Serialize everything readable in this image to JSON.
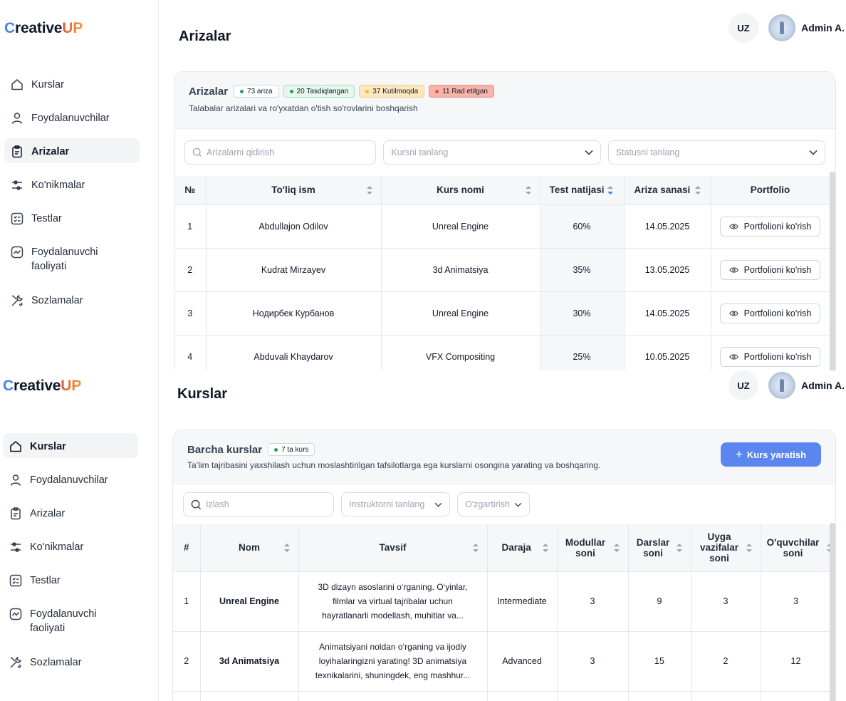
{
  "brand": {
    "c": "C",
    "reative": "reative",
    "up": "UP"
  },
  "nav": [
    {
      "label": "Kurslar",
      "icon": "home-icon"
    },
    {
      "label": "Foydalanuvchilar",
      "icon": "user-icon"
    },
    {
      "label": "Arizalar",
      "icon": "clipboard-icon"
    },
    {
      "label": "Ko'nikmalar",
      "icon": "sliders-icon"
    },
    {
      "label": "Testlar",
      "icon": "checklist-icon"
    },
    {
      "label": "Foydalanuvchi faoliyati",
      "icon": "activity-icon"
    },
    {
      "label": "Sozlamalar",
      "icon": "tools-icon"
    }
  ],
  "header": {
    "lang": "UZ",
    "user": "Admin A."
  },
  "arizalar": {
    "page_title": "Arizalar",
    "card_title": "Arizalar",
    "badges": [
      {
        "text": "73 ariza",
        "dot": "#22a05a",
        "bg": "#ffffff",
        "border": "#d1d5db"
      },
      {
        "text": "20 Tasdiqlangan",
        "dot": "#22a05a",
        "bg": "#e6f7ec",
        "border": "#a9dfbe"
      },
      {
        "text": "37 Kutilmoqda",
        "dot": "#e5b93a",
        "bg": "#fbe8bf",
        "border": "#edce86"
      },
      {
        "text": "11 Rad etilgan",
        "dot": "#e0513e",
        "bg": "#f8b4a8",
        "border": "#ec8f80"
      }
    ],
    "subtitle": "Talabalar arizalari va ro'yxatdan o'tish so'rovlarini boshqarish",
    "search_placeholder": "Arizalarni qidirish",
    "course_select": "Kursni tanlang",
    "status_select": "Statusni tanlang",
    "columns": [
      "№",
      "To'liq ism",
      "Kurs nomi",
      "Test natijasi",
      "Ariza sanasi",
      "Portfolio"
    ],
    "portfolio_label": "Portfolioni ko'rish",
    "rows": [
      {
        "n": "1",
        "name": "Abdullajon Odilov",
        "course": "Unreal Engine",
        "score": "60%",
        "date": "14.05.2025"
      },
      {
        "n": "2",
        "name": "Kudrat Mirzayev",
        "course": "3d Animatsiya",
        "score": "35%",
        "date": "13.05.2025"
      },
      {
        "n": "3",
        "name": "Нодирбек Курбанов",
        "course": "Unreal Engine",
        "score": "30%",
        "date": "14.05.2025"
      },
      {
        "n": "4",
        "name": "Abduvali Khaydarov",
        "course": "VFX Compositing",
        "score": "25%",
        "date": "10.05.2025"
      }
    ]
  },
  "kurslar": {
    "page_title": "Kurslar",
    "card_title": "Barcha kurslar",
    "badge": "7 ta kurs",
    "subtitle": "Ta’lim tajribasini yaxshilash uchun moslashtirilgan tafsilotlarga ega kurslarni osongina yarating va boshqaring.",
    "create_button": "Kurs yaratish",
    "search_placeholder": "Izlash",
    "instructor_select": "Instruktorni tanlang",
    "change_select": "O'zgartirish",
    "columns": [
      "#",
      "Nom",
      "Tavsif",
      "Daraja",
      "Modullar soni",
      "Darslar soni",
      "Uyga vazifalar soni",
      "O'quvchilar soni"
    ],
    "rows": [
      {
        "n": "1",
        "name": "Unreal Engine",
        "desc": "3D dizayn asoslarini o‘rganing. O‘yinlar, filmlar va virtual tajribalar uchun hayratlanarli modellash, muhitlar va...",
        "level": "Intermediate",
        "modules": "3",
        "lessons": "9",
        "homework": "3",
        "students": "3"
      },
      {
        "n": "2",
        "name": "3d Animatsiya",
        "desc": "Animatsiyani noldan o‘rganing va ijodiy loyihalaringizni yarating! 3D animatsiya texnikalarini, shuningdek, eng mashhur...",
        "level": "Advanced",
        "modules": "3",
        "lessons": "15",
        "homework": "2",
        "students": "12"
      }
    ]
  }
}
